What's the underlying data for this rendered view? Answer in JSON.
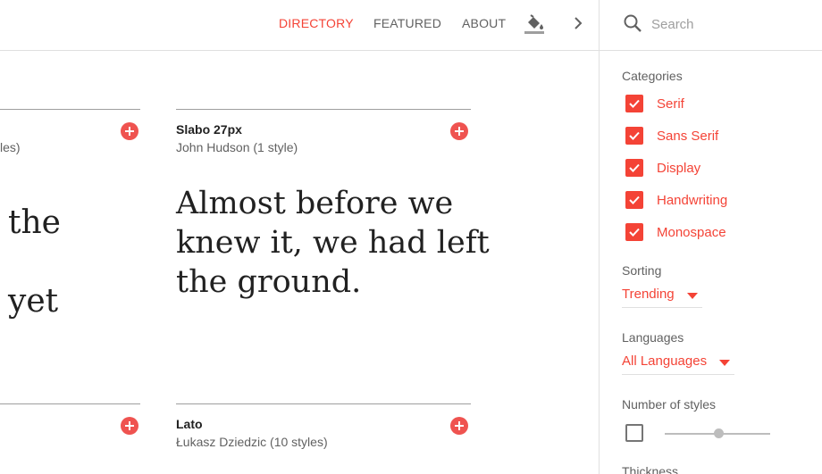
{
  "nav": {
    "directory": "DIRECTORY",
    "featured": "FEATURED",
    "about": "ABOUT",
    "theme_icon": "paint-bucket-icon",
    "more_icon": "chevron-right-icon"
  },
  "search": {
    "placeholder": "Search",
    "icon": "search-icon"
  },
  "sidebar": {
    "categories_title": "Categories",
    "categories": [
      {
        "label": "Serif",
        "checked": true
      },
      {
        "label": "Sans Serif",
        "checked": true
      },
      {
        "label": "Display",
        "checked": true
      },
      {
        "label": "Handwriting",
        "checked": true
      },
      {
        "label": "Monospace",
        "checked": true
      }
    ],
    "sorting_title": "Sorting",
    "sorting_value": "Trending",
    "languages_title": "Languages",
    "languages_value": "All Languages",
    "styles_title": "Number of styles",
    "styles_checked": false,
    "thickness_title": "Thickness"
  },
  "cards": {
    "left_top": {
      "meta": "les)",
      "sample": "the\nyet"
    },
    "slabo": {
      "name": "Slabo 27px",
      "meta": "John Hudson (1 style)",
      "sample": "Almost before we\nknew it, we had left\nthe ground."
    },
    "lato": {
      "name": "Lato",
      "meta": "Łukasz Dziedzic (10 styles)"
    }
  },
  "colors": {
    "accent": "#f44336",
    "text": "#212121",
    "muted": "#616161",
    "divider": "#e0e0e0"
  }
}
